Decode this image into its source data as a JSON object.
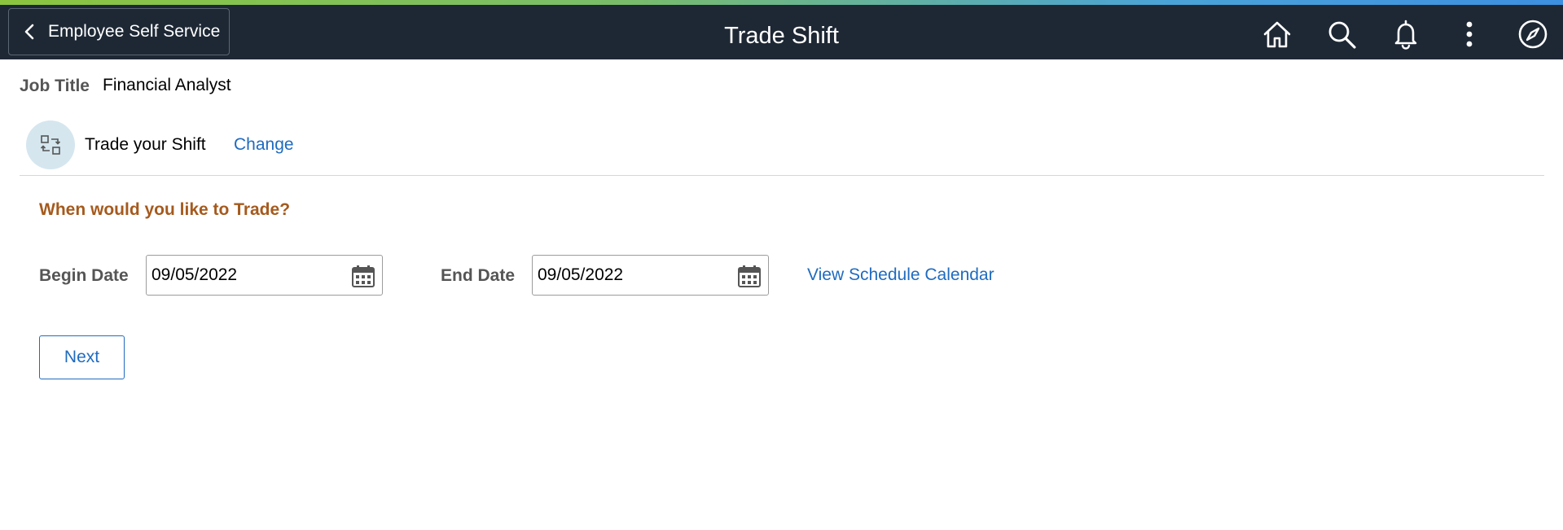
{
  "colors": {
    "header_bg": "#1e2835",
    "link": "#1f6bbf",
    "question": "#a55a1d",
    "label": "#555555",
    "icon_circle": "#d5e6ef"
  },
  "header": {
    "back_label": "Employee Self Service",
    "title": "Trade Shift",
    "icons": [
      "home-icon",
      "search-icon",
      "bell-icon",
      "more-vertical-icon",
      "compass-icon"
    ]
  },
  "job": {
    "label": "Job Title",
    "value": "Financial Analyst"
  },
  "trade": {
    "label": "Trade your Shift",
    "change_link": "Change",
    "icon": "swap-icon"
  },
  "form": {
    "question": "When would you like to Trade?",
    "begin_label": "Begin Date",
    "begin_value": "09/05/2022",
    "end_label": "End Date",
    "end_value": "09/05/2022",
    "calendar_link": "View Schedule Calendar",
    "next_label": "Next"
  }
}
